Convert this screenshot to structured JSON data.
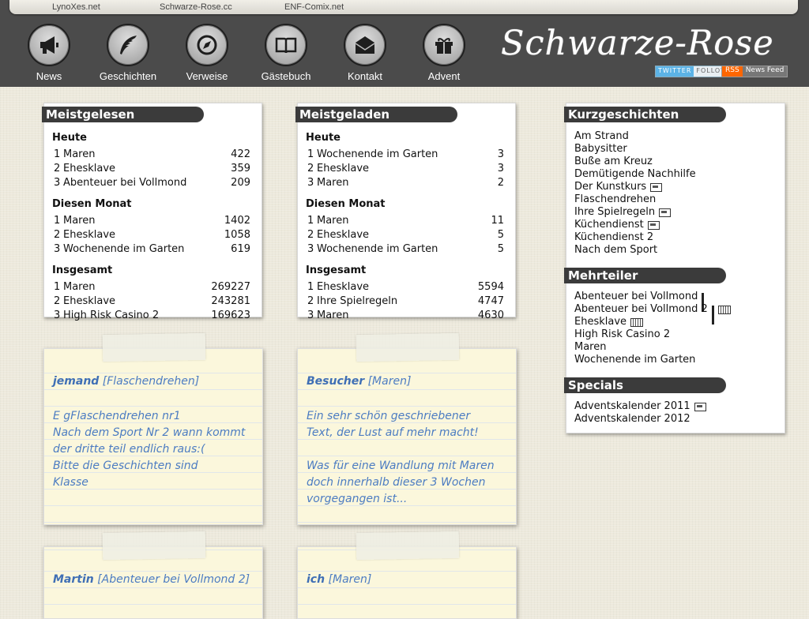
{
  "top_links": [
    "LynoXes.net",
    "Schwarze-Rose.cc",
    "ENF-Comix.net"
  ],
  "nav": [
    {
      "label": "News",
      "icon": "megaphone-icon"
    },
    {
      "label": "Geschichten",
      "icon": "feather-quill-icon"
    },
    {
      "label": "Verweise",
      "icon": "compass-icon"
    },
    {
      "label": "Gästebuch",
      "icon": "book-icon"
    },
    {
      "label": "Kontakt",
      "icon": "envelope-icon"
    },
    {
      "label": "Advent",
      "icon": "gift-icon"
    }
  ],
  "logo": "Schwarze-Rose",
  "badges": {
    "twitter_a": "TWITTER",
    "twitter_b": "FOLLOW",
    "rss_a": "RSS",
    "rss_b": "News Feed"
  },
  "meistgelesen": {
    "title": "Meistgelesen",
    "groups": [
      {
        "heading": "Heute",
        "rows": [
          [
            "1",
            "Maren",
            "422"
          ],
          [
            "2",
            "Ehesklave",
            "359"
          ],
          [
            "3",
            "Abenteuer bei Vollmond",
            "209"
          ]
        ]
      },
      {
        "heading": "Diesen Monat",
        "rows": [
          [
            "1",
            "Maren",
            "1402"
          ],
          [
            "2",
            "Ehesklave",
            "1058"
          ],
          [
            "3",
            "Wochenende im Garten",
            "619"
          ]
        ]
      },
      {
        "heading": "Insgesamt",
        "rows": [
          [
            "1",
            "Maren",
            "269227"
          ],
          [
            "2",
            "Ehesklave",
            "243281"
          ],
          [
            "3",
            "High Risk Casino 2",
            "169623"
          ]
        ]
      }
    ]
  },
  "meistgeladen": {
    "title": "Meistgeladen",
    "groups": [
      {
        "heading": "Heute",
        "rows": [
          [
            "1",
            "Wochenende im Garten",
            "3"
          ],
          [
            "2",
            "Ehesklave",
            "3"
          ],
          [
            "3",
            "Maren",
            "2"
          ]
        ]
      },
      {
        "heading": "Diesen Monat",
        "rows": [
          [
            "1",
            "Maren",
            "11"
          ],
          [
            "2",
            "Ehesklave",
            "5"
          ],
          [
            "3",
            "Wochenende im Garten",
            "5"
          ]
        ]
      },
      {
        "heading": "Insgesamt",
        "rows": [
          [
            "1",
            "Ehesklave",
            "5594"
          ],
          [
            "2",
            "Ihre Spielregeln",
            "4747"
          ],
          [
            "3",
            "Maren",
            "4630"
          ]
        ]
      }
    ]
  },
  "kurzgeschichten": {
    "title": "Kurzgeschichten",
    "items": [
      {
        "label": "Am Strand",
        "icons": []
      },
      {
        "label": "Babysitter",
        "icons": []
      },
      {
        "label": "Buße am Kreuz",
        "icons": []
      },
      {
        "label": "Demütigende Nachhilfe",
        "icons": []
      },
      {
        "label": "Der Kunstkurs",
        "icons": [
          "picture"
        ]
      },
      {
        "label": "Flaschendrehen",
        "icons": []
      },
      {
        "label": "Ihre Spielregeln",
        "icons": [
          "picture"
        ]
      },
      {
        "label": "Küchendienst",
        "icons": [
          "picture"
        ]
      },
      {
        "label": "Küchendienst 2",
        "icons": []
      },
      {
        "label": "Nach dem Sport",
        "icons": []
      }
    ]
  },
  "mehrteiler": {
    "title": "Mehrteiler",
    "items": [
      {
        "label": "Abenteuer bei Vollmond",
        "icons": [
          "bars"
        ]
      },
      {
        "label": "Abenteuer bei Vollmond 2",
        "icons": [
          "bars",
          "keyboard"
        ]
      },
      {
        "label": "Ehesklave",
        "icons": [
          "keyboard"
        ]
      },
      {
        "label": "High Risk Casino 2",
        "icons": []
      },
      {
        "label": "Maren",
        "icons": []
      },
      {
        "label": "Wochenende im Garten",
        "icons": []
      }
    ]
  },
  "specials": {
    "title": "Specials",
    "items": [
      {
        "label": "Adventskalender 2011",
        "icons": [
          "picture"
        ]
      },
      {
        "label": "Adventskalender 2012",
        "icons": []
      }
    ]
  },
  "notes": [
    {
      "author": "jemand",
      "story": "[Flaschendrehen]",
      "lines": [
        "E gFlaschendrehen nr1",
        "Nach dem Sport Nr 2 wann kommt",
        "der dritte teil endlich raus:(",
        "Bitte die Geschichten sind",
        "Klasse"
      ]
    },
    {
      "author": "Besucher",
      "story": "[Maren]",
      "lines": [
        "Ein sehr schön geschriebener",
        "Text, der Lust auf mehr macht!",
        "",
        "Was für eine Wandlung mit Maren",
        "doch innerhalb dieser 3 Wochen",
        "vorgegangen ist..."
      ]
    },
    {
      "author": "Martin",
      "story": "[Abenteuer bei Vollmond 2]",
      "lines": []
    },
    {
      "author": "ich",
      "story": "[Maren]",
      "lines": []
    }
  ],
  "colors": {
    "topbar": "#4b4b4b",
    "tab": "#3b3b3b",
    "note_text": "#4c7cc2",
    "note_bg": "#fbf7dc"
  }
}
